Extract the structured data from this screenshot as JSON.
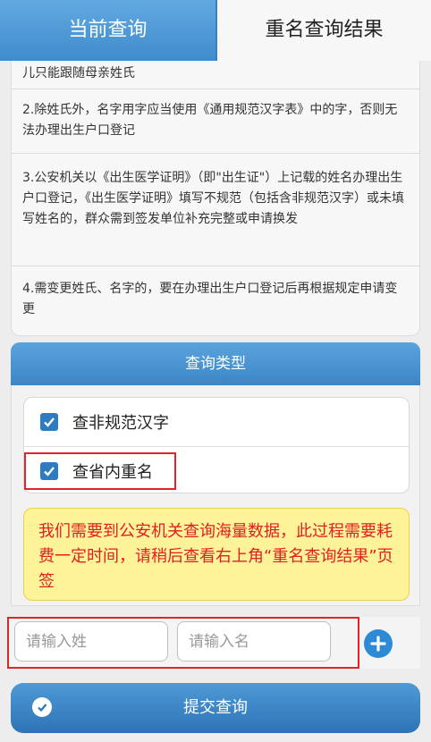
{
  "tabs": {
    "active": "当前查询",
    "inactive": "重名查询结果"
  },
  "notes": [
    "儿只能跟随母亲姓氏",
    "2.除姓氏外，名字用字应当使用《通用规范汉字表》中的字，否则无法办理出生户口登记",
    "3.公安机关以《出生医学证明》（即\"出生证\"）上记载的姓名办理出生户口登记，《出生医学证明》填写不规范（包括含非规范汉字）或未填写姓名的，群众需到签发单位补充完整或申请换发",
    "4.需变更姓氏、名字的，要在办理出生户口登记后再根据规定申请变更"
  ],
  "query_type": {
    "title": "查询类型",
    "options": [
      {
        "label": "查非规范汉字",
        "checked": true
      },
      {
        "label": "查省内重名",
        "checked": true
      }
    ],
    "warning": "我们需要到公安机关查询海量数据，此过程需要耗费一定时间，请稍后查看右上角“重名查询结果”页签"
  },
  "form": {
    "surname_placeholder": "请输入姓",
    "name_placeholder": "请输入名"
  },
  "submit_label": "提交查询",
  "colors": {
    "accent": "#3f8ccd",
    "warning_bg": "#fff39a",
    "warning_text": "#e02020",
    "highlight": "#e0242b"
  }
}
